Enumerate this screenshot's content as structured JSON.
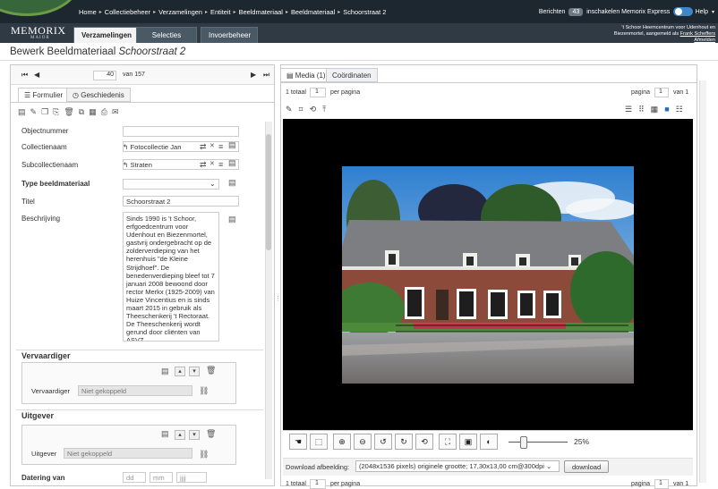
{
  "topbar": {
    "breadcrumb": [
      "Home",
      "Collectiebeheer",
      "Verzamelingen",
      "Entiteit",
      "Beeldmateriaal",
      "Beeldmateriaal",
      "Schoorstraat 2"
    ],
    "messages_label": "Berichten",
    "messages_count": "43",
    "express_label": "inschakelen Memorix Express",
    "express_count": "0",
    "help_label": "Help"
  },
  "header": {
    "logo": "MEMORIX",
    "logo_sub": "MAIOR",
    "tabs": [
      {
        "label": "Verzamelingen",
        "active": true
      },
      {
        "label": "Selecties",
        "active": false
      },
      {
        "label": "Invoerbeheer",
        "active": false
      }
    ],
    "info_line1": "'t Schoor Heemcentrum voor Udenhout en",
    "info_line2": "Biezenmortel, aangemeld als",
    "info_user": "Frank Scheffers",
    "logout": "Afmelden"
  },
  "page": {
    "title_prefix": "Bewerk Beeldmateriaal",
    "title_record": "Schoorstraat 2"
  },
  "pager": {
    "current": "40",
    "total_text": "van 157"
  },
  "left_tabs": [
    "Formulier",
    "Geschiedenis"
  ],
  "form": {
    "objectnummer_label": "Objectnummer",
    "objectnummer_value": "",
    "collectienaam_label": "Collectienaam",
    "collectienaam_value": "Fotocollectie Jan",
    "subcollectienaam_label": "Subcollectienaam",
    "subcollectienaam_value": "Straten",
    "type_label": "Type beeldmateriaal",
    "type_value": "",
    "titel_label": "Titel",
    "titel_value": "Schoorstraat 2",
    "beschrijving_label": "Beschrijving",
    "beschrijving_value": "Sinds 1990 is 't Schoor,\nerfgoedcentrum voor\nUdenhout en Biezenmortel,\ngastvrij ondergebracht op de\nzolderverdieping van het\nherenhuis \"de Kleine\nStrijdhoef\". De\nbenedenverdieping bleef tot 7\njanuari 2008 bewoond door\nrector Merkx (1925-2009) van\nHuize Vincentius en is sinds\nmaart 2015 in gebruik als\nTheeschenkerij 't Rectoraat.\nDe Theeschenkerij wordt\ngerund door cliënten van\nASVZ.",
    "vervaardiger_heading": "Vervaardiger",
    "vervaardiger_label": "Vervaardiger",
    "vervaardiger_value": "Niet gekoppeld",
    "uitgever_heading": "Uitgever",
    "uitgever_label": "Uitgever",
    "uitgever_value": "Niet gekoppeld",
    "datering_label": "Datering van",
    "date_dd": "dd",
    "date_mm": "mm",
    "date_jjjj": "jjjj"
  },
  "media": {
    "tabs": [
      "Media (1)",
      "Coördinaten"
    ],
    "total_label": "1 totaal",
    "per_page_value": "1",
    "per_page_label": "per pagina",
    "page_label": "pagina",
    "page_value": "1",
    "page_of": "van 1",
    "zoom": "25%",
    "zoom_level": 0.25,
    "download_label": "Download afbeelding:",
    "download_option": "(2048x1536 pixels) originele grootte; 17,30x13,00 cm@300dpi",
    "download_button": "download",
    "bottom_total": "1 totaal",
    "bottom_per_page_value": "1",
    "bottom_per_page": "per pagina",
    "bottom_page": "pagina",
    "bottom_page_value": "1",
    "bottom_of": "van 1"
  },
  "colors": {
    "topbar": "#1d2730",
    "header": "#2f3a45",
    "accent": "#3e86c8"
  }
}
